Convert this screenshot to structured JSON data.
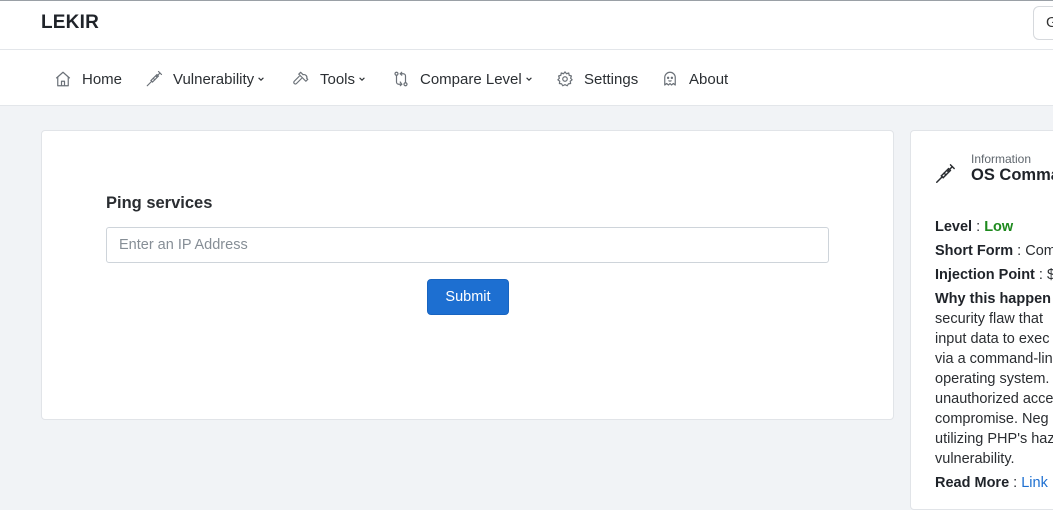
{
  "app": {
    "brand": "LEKIR",
    "topbar_button_glyph": "G"
  },
  "nav": {
    "items": [
      {
        "label": "Home",
        "icon": "home-icon",
        "dropdown": false
      },
      {
        "label": "Vulnerability",
        "icon": "syringe-icon",
        "dropdown": true
      },
      {
        "label": "Tools",
        "icon": "wrench-icon",
        "dropdown": true
      },
      {
        "label": "Compare Level",
        "icon": "compare-icon",
        "dropdown": true
      },
      {
        "label": "Settings",
        "icon": "gear-icon",
        "dropdown": false
      },
      {
        "label": "About",
        "icon": "ghost-icon",
        "dropdown": false
      }
    ]
  },
  "form": {
    "title": "Ping services",
    "input_placeholder": "Enter an IP Address",
    "input_value": "",
    "submit_label": "Submit"
  },
  "info": {
    "label": "Information",
    "title": "OS Comma",
    "level_label": "Level",
    "level_value": "Low",
    "short_form_label": "Short Form",
    "short_form_value": "Com",
    "injection_label": "Injection Point",
    "injection_value": "$",
    "why_label": "Why this happen",
    "description_lines": [
      "security flaw that",
      "input data to exec",
      "via a command-lin",
      "operating system.",
      "unauthorized acce",
      "compromise. Neg",
      "utilizing PHP's haz",
      "vulnerability."
    ],
    "read_more_label": "Read More",
    "read_more_link": "Link"
  },
  "colors": {
    "accent": "#1d6fd1",
    "level_low": "#1e8a1e",
    "page_bg": "#f1f3f6"
  }
}
